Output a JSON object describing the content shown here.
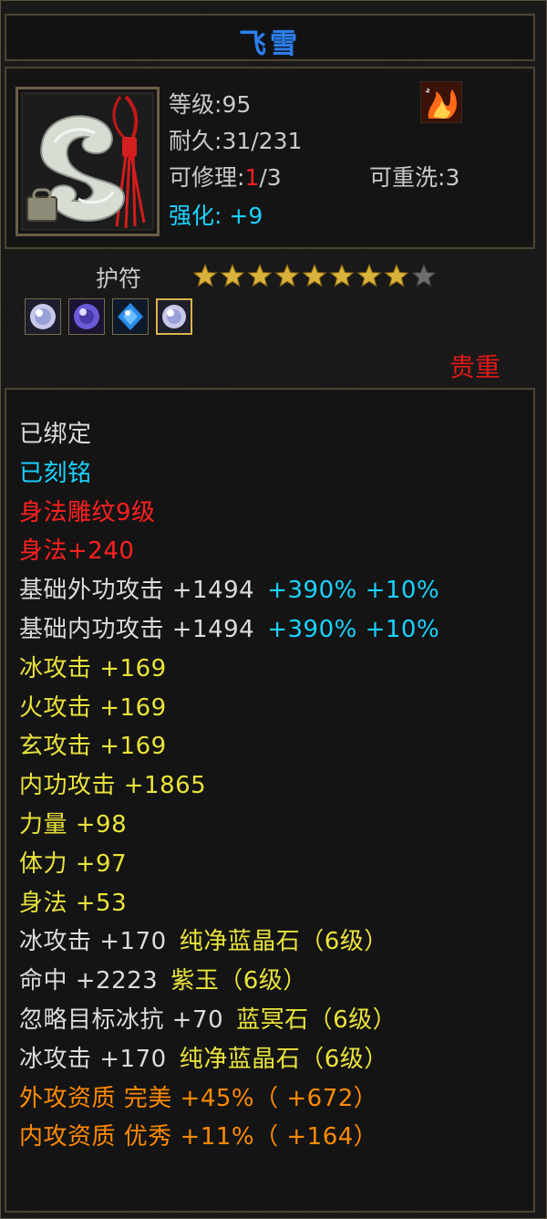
{
  "item": {
    "name": "飞雪",
    "level_label": "等级:",
    "level_value": "95",
    "durability_label": "耐久:",
    "durability_value": "31/231",
    "repair_label": "可修理:",
    "repair_current": "1",
    "repair_total": "/3",
    "rewash_label": "可重洗:",
    "rewash_value": "3",
    "enhance_label": "强化:",
    "enhance_value": "+9",
    "slot_label": "护符",
    "stars_filled": 8,
    "stars_total": 9,
    "rarity_label": "贵重"
  },
  "gem_icons": [
    "silver-gem-icon",
    "purple-gem-icon",
    "blue-gem-icon",
    "silver-gem-icon-selected"
  ],
  "colors": {
    "title": "#2f7fe8",
    "white": "#dcdcdc",
    "cyan": "#19d3ff",
    "red": "#ff2020",
    "yellow": "#e9e33b",
    "orange": "#ff8a00"
  },
  "attributes": [
    {
      "text": "已绑定",
      "color": "white"
    },
    {
      "text": "已刻铭",
      "color": "cyan"
    },
    {
      "text": "身法雕纹9级",
      "color": "red"
    },
    {
      "text": "身法+240",
      "color": "red"
    },
    {
      "text": "基础外功攻击 +1494",
      "color": "white",
      "extra": "+390% +10%",
      "extra_color": "cyan"
    },
    {
      "text": "基础内功攻击 +1494",
      "color": "white",
      "extra": "+390% +10%",
      "extra_color": "cyan"
    },
    {
      "text": "冰攻击 +169",
      "color": "yellow"
    },
    {
      "text": "火攻击 +169",
      "color": "yellow"
    },
    {
      "text": "玄攻击 +169",
      "color": "yellow"
    },
    {
      "text": "内功攻击 +1865",
      "color": "yellow"
    },
    {
      "text": "力量 +98",
      "color": "yellow"
    },
    {
      "text": "体力 +97",
      "color": "yellow"
    },
    {
      "text": "身法 +53",
      "color": "yellow"
    },
    {
      "text": "冰攻击 +170",
      "color": "white",
      "extra": "纯净蓝晶石（6级）",
      "extra_color": "yellow"
    },
    {
      "text": "命中 +2223",
      "color": "white",
      "extra": "紫玉（6级）",
      "extra_color": "yellow"
    },
    {
      "text": "忽略目标冰抗 +70",
      "color": "white",
      "extra": "蓝冥石（6级）",
      "extra_color": "yellow"
    },
    {
      "text": "冰攻击 +170",
      "color": "white",
      "extra": "纯净蓝晶石（6级）",
      "extra_color": "yellow"
    },
    {
      "text": "外攻资质  完美 +45%（ +672）",
      "color": "orange"
    },
    {
      "text": "内攻资质  优秀 +11%（ +164）",
      "color": "orange"
    }
  ]
}
